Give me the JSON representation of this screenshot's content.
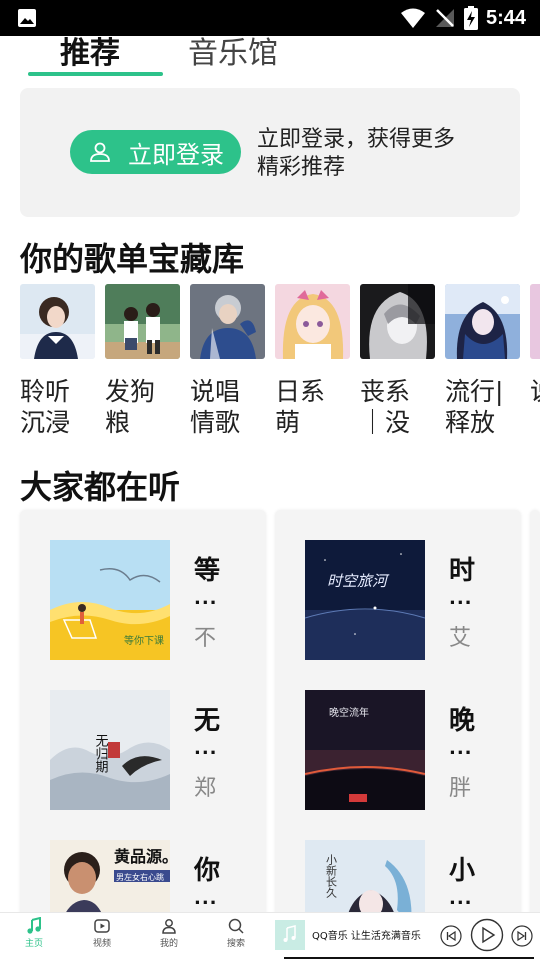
{
  "status": {
    "time": "5:44"
  },
  "tabs": {
    "recommend": "推荐",
    "music_hall": "音乐馆"
  },
  "login": {
    "button": "立即登录",
    "prompt": "立即登录，获得更多精彩推荐"
  },
  "sections": {
    "library_title": "你的歌单宝藏库",
    "popular_title": "大家都在听"
  },
  "playlists": [
    {
      "name": "聆听沉浸"
    },
    {
      "name": "发狗粮"
    },
    {
      "name": "说唱情歌"
    },
    {
      "name": "日系萌"
    },
    {
      "name": "丧系｜没"
    },
    {
      "name": "流行|释放"
    },
    {
      "name": "说甜"
    }
  ],
  "songs": {
    "left": [
      {
        "title": "等",
        "ellipsis": "...",
        "artist": "不"
      },
      {
        "title": "无",
        "ellipsis": "...",
        "artist": "郑"
      },
      {
        "title": "你",
        "ellipsis": "...",
        "artist": ""
      }
    ],
    "right": [
      {
        "title": "时",
        "ellipsis": "...",
        "artist": "艾"
      },
      {
        "title": "晚",
        "ellipsis": "...",
        "artist": "胖"
      },
      {
        "title": "小",
        "ellipsis": "...",
        "artist": ""
      }
    ]
  },
  "cover_text": {
    "l1": "等你下课",
    "l2": "无归期",
    "l3": "黄品源。",
    "l3b": "男左女右心跳",
    "r1": "时空旅河",
    "r2": "晚空流年",
    "r3": "小新长久"
  },
  "nav": {
    "home": "主页",
    "video": "视频",
    "mine": "我的",
    "search": "搜索"
  },
  "player": {
    "text": "QQ音乐 让生活充满音乐"
  },
  "colors": {
    "accent": "#2dc28a"
  }
}
